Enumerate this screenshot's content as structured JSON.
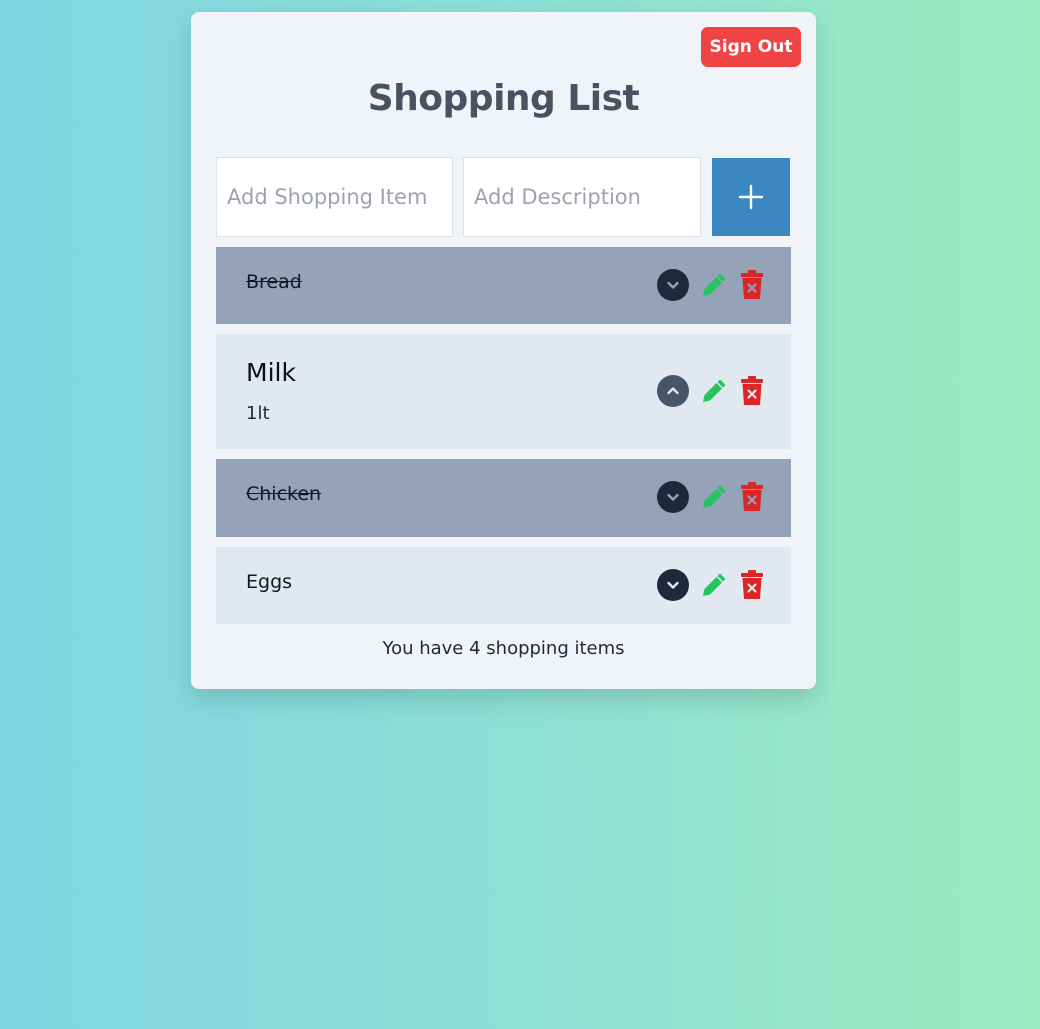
{
  "header": {
    "sign_out_label": "Sign Out",
    "title": "Shopping List"
  },
  "form": {
    "item_placeholder": "Add Shopping Item",
    "description_placeholder": "Add Description",
    "add_icon": "plus-icon"
  },
  "items": [
    {
      "name": "Bread",
      "description": "",
      "completed": true,
      "expanded": false
    },
    {
      "name": "Milk",
      "description": "1lt",
      "completed": false,
      "expanded": true
    },
    {
      "name": "Chicken",
      "description": "",
      "completed": true,
      "expanded": false
    },
    {
      "name": "Eggs",
      "description": "",
      "completed": false,
      "expanded": false
    }
  ],
  "footer": {
    "count_text": "You have 4 shopping items"
  },
  "colors": {
    "sign_out": "#ef4444",
    "add_button": "#3b87c1",
    "completed_row": "#94a3b8",
    "open_row": "#e2e8f0",
    "edit_icon": "#22c55e",
    "delete_icon": "#dc2626"
  }
}
